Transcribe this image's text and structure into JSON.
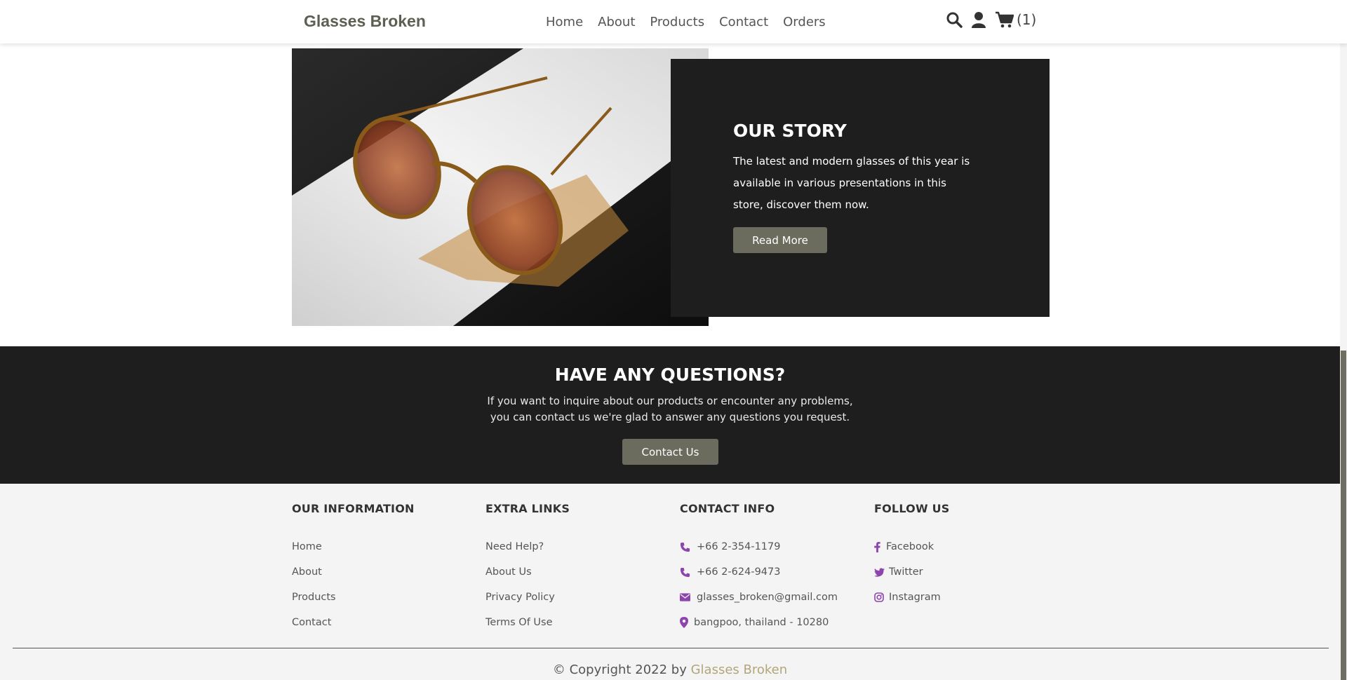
{
  "header": {
    "brand": "Glasses Broken",
    "nav": [
      "Home",
      "About",
      "Products",
      "Contact",
      "Orders"
    ],
    "cart_count": "(1)"
  },
  "story": {
    "title": "OUR STORY",
    "text": "The latest and modern glasses of this year is available in various presentations in this store, discover them now.",
    "button": "Read More"
  },
  "questions": {
    "title": "HAVE ANY QUESTIONS?",
    "text": "If you want to inquire about our products or encounter any problems, you can contact us we're glad to answer any questions you request.",
    "button": "Contact Us"
  },
  "footer": {
    "info": {
      "title": "OUR INFORMATION",
      "items": [
        "Home",
        "About",
        "Products",
        "Contact"
      ]
    },
    "links": {
      "title": "EXTRA LINKS",
      "items": [
        "Need Help?",
        "About Us",
        "Privacy Policy",
        "Terms Of Use"
      ]
    },
    "contact": {
      "title": "CONTACT INFO",
      "items": [
        "+66 2-354-1179",
        "+66 2-624-9473",
        "glasses_broken@gmail.com",
        "bangpoo, thailand - 10280"
      ]
    },
    "follow": {
      "title": "FOLLOW US",
      "items": [
        "Facebook",
        "Twitter",
        "Instagram"
      ]
    },
    "copyright_prefix": "© Copyright 2022 by",
    "copyright_brand": "Glasses Broken"
  },
  "colors": {
    "accent": "#6b6b5e",
    "dark": "#1e1e1e",
    "icon_purple": "#8e44ad",
    "brand_gold": "#b3a57a"
  }
}
